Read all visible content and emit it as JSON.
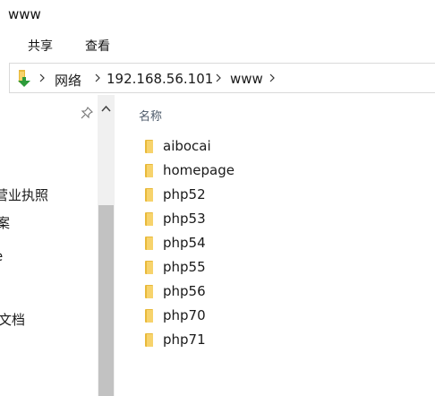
{
  "window": {
    "title": "www"
  },
  "ribbon": {
    "tabs": [
      "共享",
      "查看"
    ]
  },
  "address": {
    "crumbs": [
      "网络",
      "192.168.56.101",
      "www"
    ]
  },
  "nav": {
    "items": [
      "营业执照",
      "案",
      "e",
      "文档"
    ]
  },
  "list": {
    "header": "名称",
    "items": [
      "aibocai",
      "homepage",
      "php52",
      "php53",
      "php54",
      "php55",
      "php56",
      "php70",
      "php71"
    ]
  },
  "colors": {
    "folder": "#e8b93a",
    "folder_light": "#f7d36c",
    "thumb": "#c2c2c2"
  }
}
